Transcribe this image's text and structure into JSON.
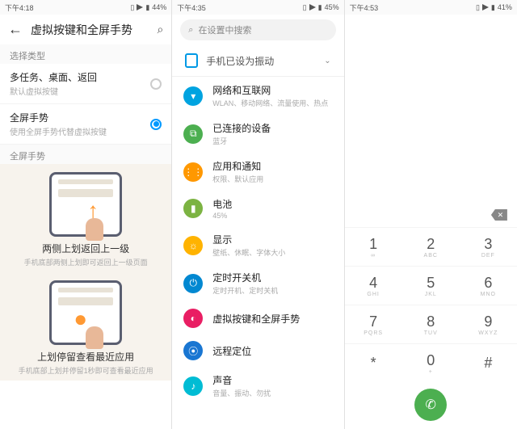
{
  "screen1": {
    "status": {
      "time": "下午4:18",
      "battery": "44%"
    },
    "title": "虚拟按键和全屏手势",
    "section_label": "选择类型",
    "opt1": {
      "title": "多任务、桌面、返回",
      "sub": "默认虚拟按键"
    },
    "opt2": {
      "title": "全屏手势",
      "sub": "使用全屏手势代替虚拟按键"
    },
    "gesture_section": "全屏手势",
    "illus1": {
      "title": "两侧上划返回上一级",
      "sub": "手机底部两侧上划即可返回上一级页面"
    },
    "illus2": {
      "title": "上划停留查看最近应用",
      "sub": "手机底部上划并停留1秒即可查看最近应用"
    }
  },
  "screen2": {
    "status": {
      "time": "下午4:35",
      "battery": "45%"
    },
    "search_placeholder": "在设置中搜索",
    "banner": "手机已设为振动",
    "items": [
      {
        "title": "网络和互联网",
        "sub": "WLAN、移动网络、流量使用、热点",
        "color": "#00a3e0",
        "glyph": "▾"
      },
      {
        "title": "已连接的设备",
        "sub": "蓝牙",
        "color": "#4caf50",
        "glyph": "⧉"
      },
      {
        "title": "应用和通知",
        "sub": "权限、默认应用",
        "color": "#ff9800",
        "glyph": "⋮⋮"
      },
      {
        "title": "电池",
        "sub": "45%",
        "color": "#7cb342",
        "glyph": "▮"
      },
      {
        "title": "显示",
        "sub": "壁纸、休眠、字体大小",
        "color": "#ffb300",
        "glyph": "☼"
      },
      {
        "title": "定时开关机",
        "sub": "定时开机、定时关机",
        "color": "#0288d1",
        "glyph": "⏻"
      },
      {
        "title": "虚拟按键和全屏手势",
        "sub": "",
        "color": "#e91e63",
        "glyph": "◐"
      },
      {
        "title": "远程定位",
        "sub": "",
        "color": "#1976d2",
        "glyph": "⦿"
      },
      {
        "title": "声音",
        "sub": "音量、振动、勿扰",
        "color": "#00bcd4",
        "glyph": "♪"
      }
    ]
  },
  "screen3": {
    "status": {
      "time": "下午4:53",
      "battery": "41%"
    },
    "keys": [
      {
        "n": "1",
        "s": "∞"
      },
      {
        "n": "2",
        "s": "ABC"
      },
      {
        "n": "3",
        "s": "DEF"
      },
      {
        "n": "4",
        "s": "GHI"
      },
      {
        "n": "5",
        "s": "JKL"
      },
      {
        "n": "6",
        "s": "MNO"
      },
      {
        "n": "7",
        "s": "PQRS"
      },
      {
        "n": "8",
        "s": "TUV"
      },
      {
        "n": "9",
        "s": "WXYZ"
      },
      {
        "n": "*",
        "s": ""
      },
      {
        "n": "0",
        "s": "+"
      },
      {
        "n": "#",
        "s": ""
      }
    ]
  }
}
